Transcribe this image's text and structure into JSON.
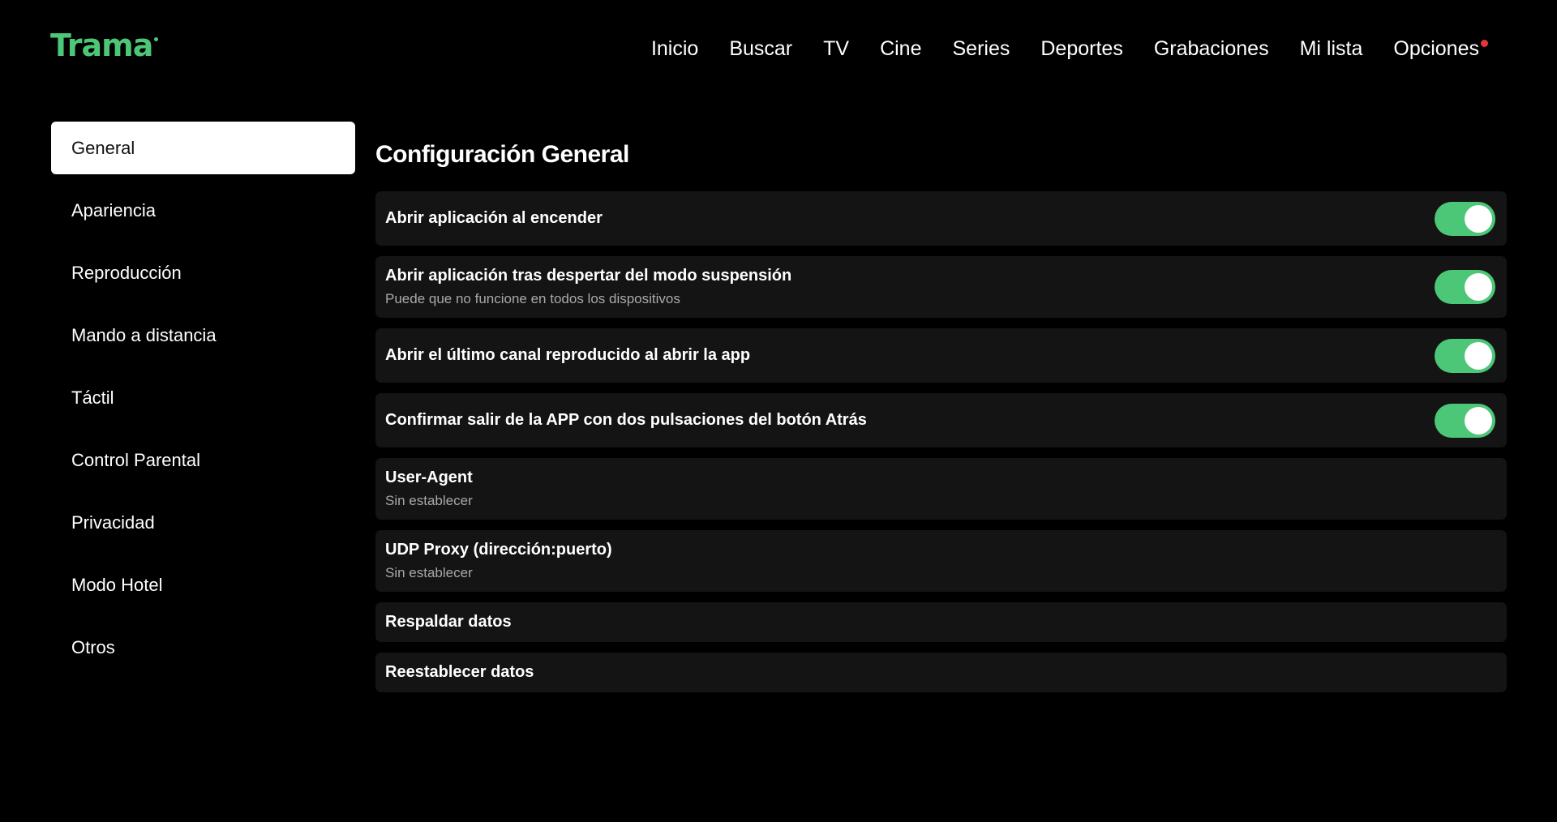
{
  "app": {
    "logo_text": "Trama",
    "accent_color": "#4cc777",
    "notification_color": "#e8323c"
  },
  "nav": {
    "items": [
      {
        "label": "Inicio"
      },
      {
        "label": "Buscar"
      },
      {
        "label": "TV"
      },
      {
        "label": "Cine"
      },
      {
        "label": "Series"
      },
      {
        "label": "Deportes"
      },
      {
        "label": "Grabaciones"
      },
      {
        "label": "Mi lista"
      },
      {
        "label": "Opciones",
        "has_notification": true
      }
    ]
  },
  "sidebar": {
    "selected": "General",
    "items": [
      {
        "label": "General"
      },
      {
        "label": "Apariencia"
      },
      {
        "label": "Reproducción"
      },
      {
        "label": "Mando a distancia"
      },
      {
        "label": "Táctil"
      },
      {
        "label": "Control Parental"
      },
      {
        "label": "Privacidad"
      },
      {
        "label": "Modo Hotel"
      },
      {
        "label": "Otros"
      }
    ]
  },
  "main": {
    "title": "Configuración General",
    "settings": [
      {
        "label": "Abrir aplicación al encender",
        "toggle": true,
        "enabled": true
      },
      {
        "label": "Abrir aplicación tras despertar del modo suspensión",
        "description": "Puede que no funcione en todos los dispositivos",
        "toggle": true,
        "enabled": true
      },
      {
        "label": "Abrir el último canal reproducido al abrir la app",
        "toggle": true,
        "enabled": true
      },
      {
        "label": "Confirmar salir de la APP con dos pulsaciones del botón Atrás",
        "toggle": true,
        "enabled": true
      },
      {
        "label": "User-Agent",
        "value": "Sin establecer"
      },
      {
        "label": "UDP Proxy (dirección:puerto)",
        "value": "Sin establecer"
      },
      {
        "label": "Respaldar datos"
      },
      {
        "label": "Reestablecer datos"
      }
    ]
  }
}
